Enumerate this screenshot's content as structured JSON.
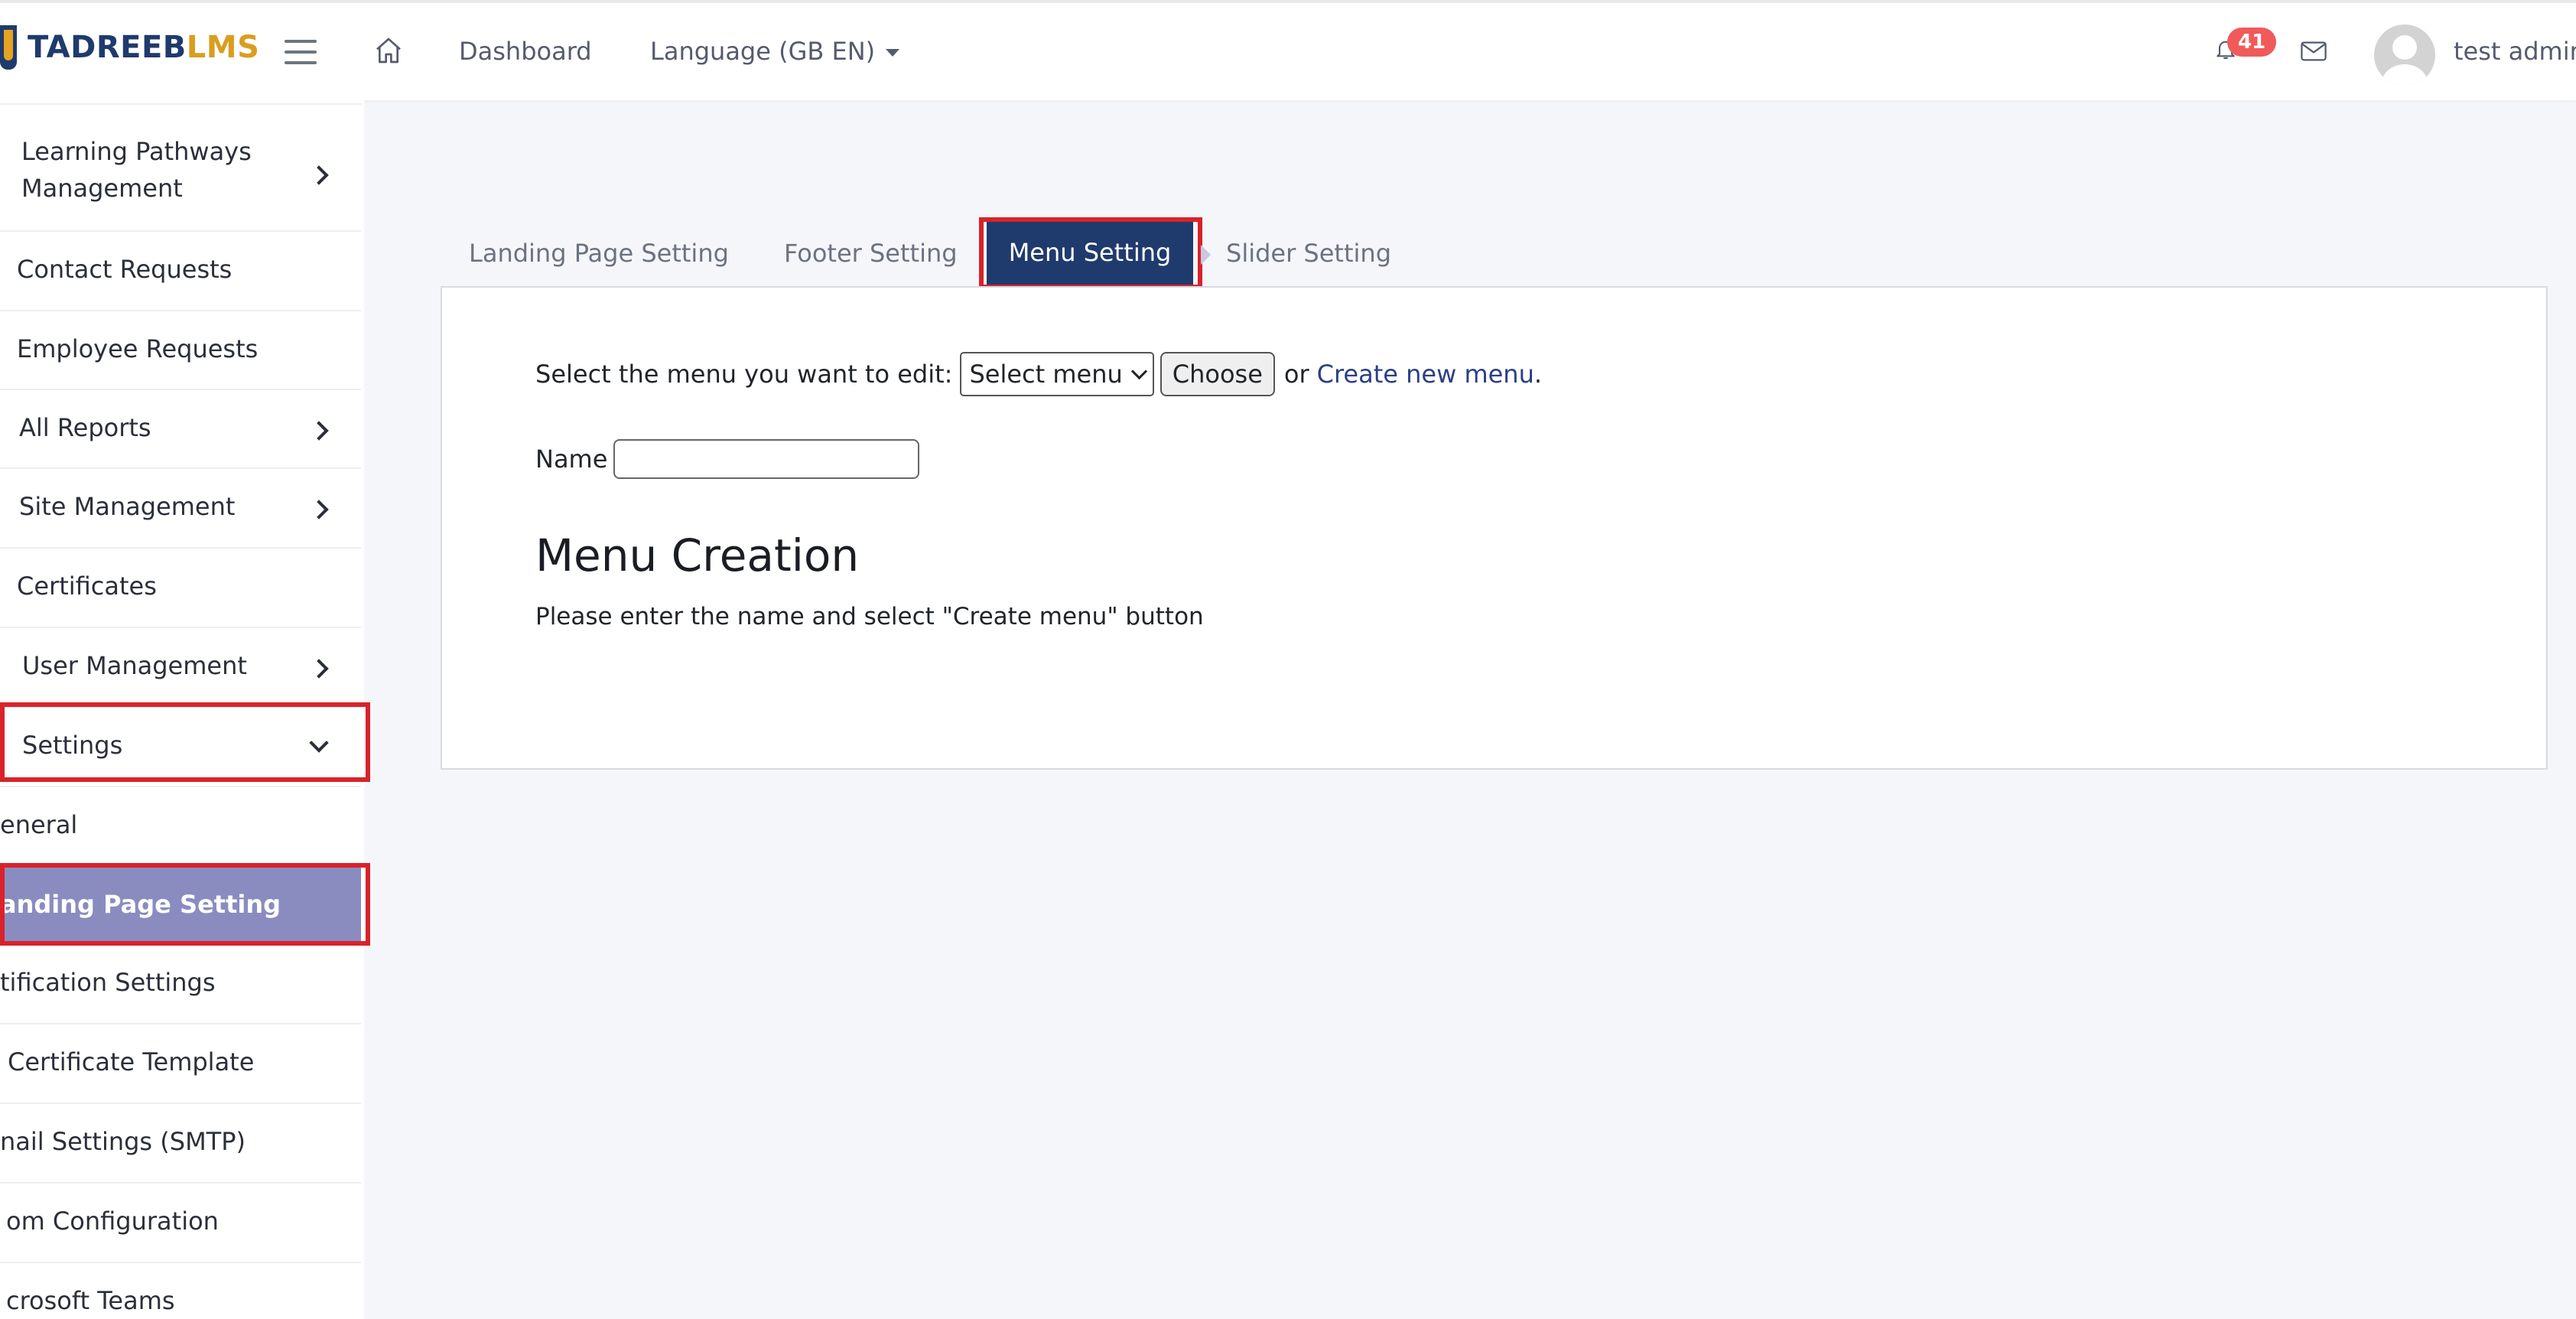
{
  "header": {
    "brand_prefix": "TADREEB",
    "brand_suffix": "LMS",
    "nav": [
      "Dashboard",
      "Language (GB EN)"
    ],
    "notification_count": "41",
    "user_name": "test admin"
  },
  "sidebar": {
    "items": [
      {
        "label": "Learning Pathways",
        "label2": "Management",
        "has_chevron": true
      },
      {
        "label": "Contact Requests"
      },
      {
        "label": "Employee Requests"
      },
      {
        "label": "All Reports",
        "has_chevron": true
      },
      {
        "label": "Site Management",
        "has_chevron": true
      },
      {
        "label": "Certificates"
      },
      {
        "label": "User Management",
        "has_chevron": true
      },
      {
        "label": "Settings",
        "expanded": true
      }
    ],
    "sub_items": [
      {
        "label": "eneral"
      },
      {
        "label": "anding Page Setting",
        "active": true
      },
      {
        "label": "tification Settings"
      },
      {
        "label": "Certificate Template"
      },
      {
        "label": "nail Settings (SMTP)"
      },
      {
        "label": "om Configuration"
      },
      {
        "label": "crosoft Teams"
      }
    ]
  },
  "tabs": [
    {
      "label": "Landing Page Setting"
    },
    {
      "label": "Footer Setting"
    },
    {
      "label": "Menu Setting",
      "active": true
    },
    {
      "label": "Slider Setting"
    }
  ],
  "menu_form": {
    "select_prompt": "Select the menu you want to edit:",
    "select_value": "Select menu",
    "choose_button": "Choose",
    "or_text": "or",
    "create_link": "Create new menu",
    "period": ".",
    "name_label": "Name",
    "name_value": "",
    "heading": "Menu Creation",
    "hint": "Please enter the name and select \"Create menu\" button"
  },
  "colors": {
    "primary": "#1f3a6d",
    "accent": "#d99e1f",
    "active_sidebar": "#8a8cc0",
    "highlight_box": "#d9222a",
    "badge": "#f05a5a"
  }
}
